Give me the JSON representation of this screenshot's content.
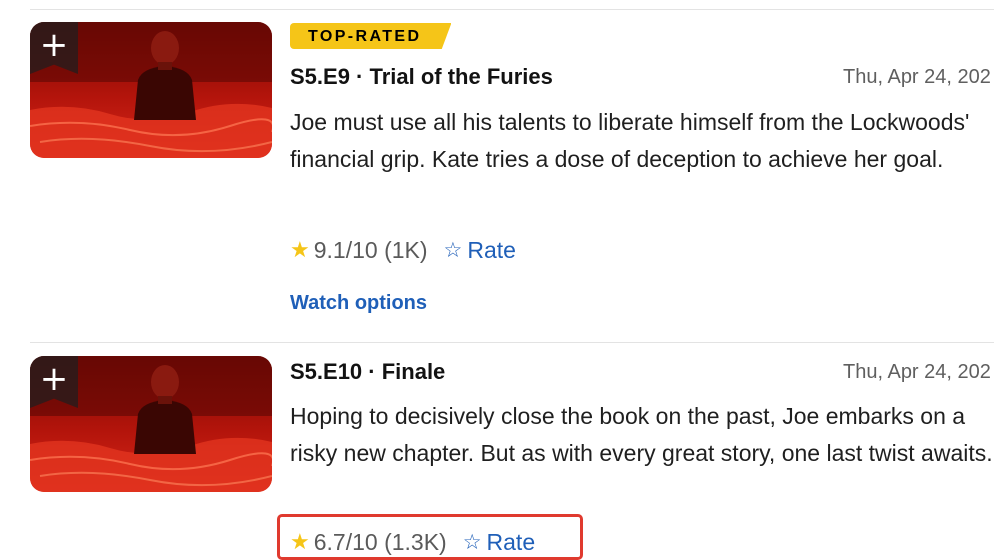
{
  "episodes": [
    {
      "badge": "TOP-RATED",
      "title": "S5.E9 · Trial of the Furies",
      "date": "Thu, Apr 24, 202",
      "description": "Joe must use all his talents to liberate himself from the Lockwoods' financial grip. Kate tries a dose of deception to achieve her goal.",
      "rating": "9.1/10 (1K)",
      "rate_label": "Rate",
      "watch_label": "Watch options",
      "add_label": "+"
    },
    {
      "title": "S5.E10 · Finale",
      "date": "Thu, Apr 24, 202",
      "description": "Hoping to decisively close the book on the past, Joe embarks on a risky new chapter. But as with every great story, one last twist awaits.",
      "rating": "6.7/10 (1.3K)",
      "rate_label": "Rate",
      "add_label": "+"
    }
  ],
  "icons": {
    "star": "star-icon",
    "rate": "star-outline-icon",
    "add": "plus-icon"
  },
  "colors": {
    "accent_yellow": "#f5c518",
    "link_blue": "#1f5fb8",
    "highlight_red": "#e03a2f"
  }
}
